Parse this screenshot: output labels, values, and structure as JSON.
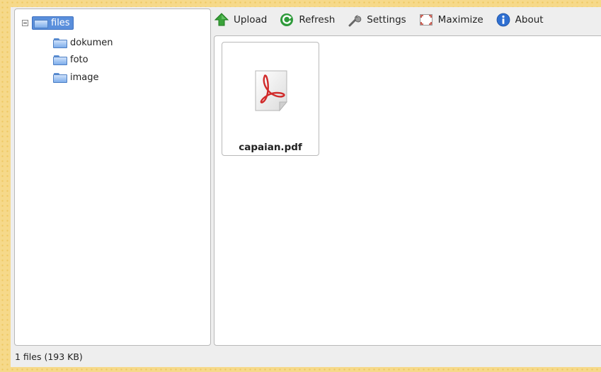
{
  "toolbar": {
    "buttons": [
      {
        "label": "Upload",
        "icon": "upload-arrow-icon"
      },
      {
        "label": "Refresh",
        "icon": "refresh-icon"
      },
      {
        "label": "Settings",
        "icon": "wrench-icon"
      },
      {
        "label": "Maximize",
        "icon": "maximize-icon"
      },
      {
        "label": "About",
        "icon": "info-icon"
      }
    ]
  },
  "tree": {
    "root": {
      "label": "files",
      "expanded": true,
      "selected": true
    },
    "children": [
      {
        "label": "dokumen"
      },
      {
        "label": "foto"
      },
      {
        "label": "image"
      }
    ]
  },
  "files": [
    {
      "name": "capaian.pdf",
      "icon": "pdf-icon"
    }
  ],
  "status": {
    "text": "1 files (193 KB)"
  },
  "colors": {
    "selection": "#5a8fdc",
    "background": "#f6d98a",
    "pdf_red": "#d12b2b"
  }
}
